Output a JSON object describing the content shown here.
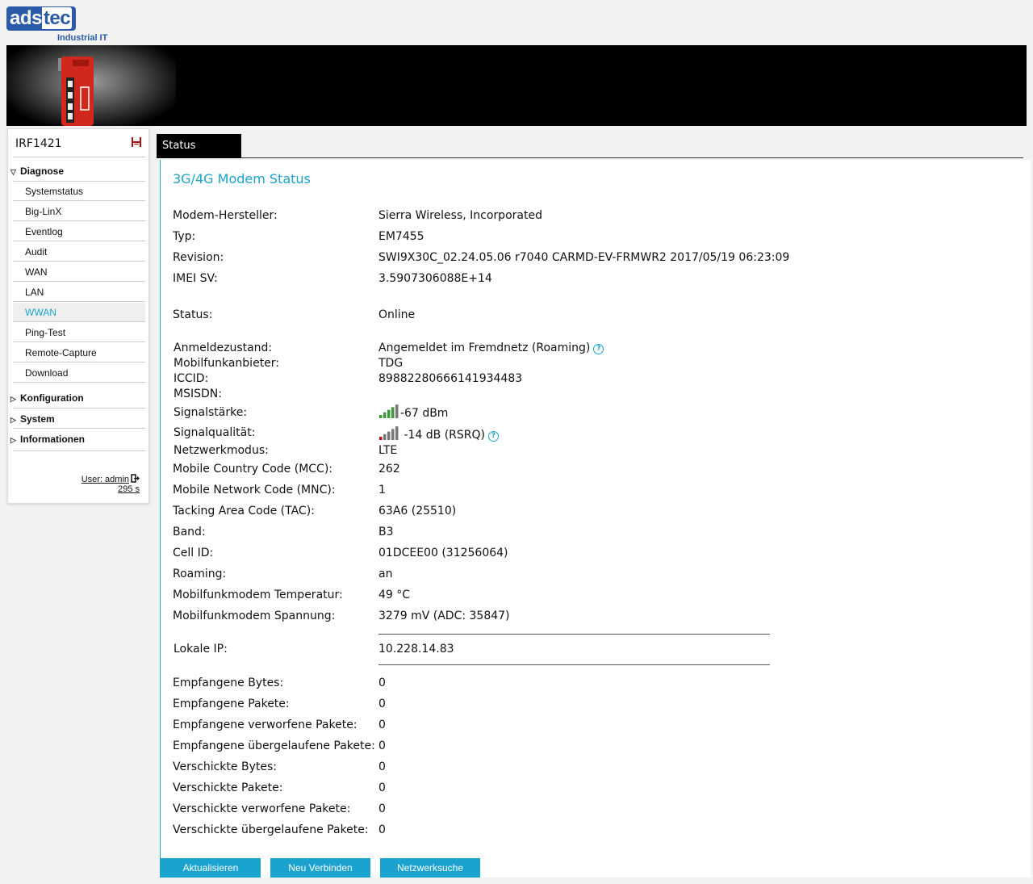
{
  "logo": {
    "left_text": "ads",
    "right_text": "tec",
    "subtitle": "Industrial IT"
  },
  "sidebar": {
    "device_name": "IRF1421",
    "groups": [
      {
        "label": "Diagnose",
        "expanded": true
      },
      {
        "label": "Konfiguration",
        "expanded": false
      },
      {
        "label": "System",
        "expanded": false
      },
      {
        "label": "Informationen",
        "expanded": false
      }
    ],
    "items": [
      "Systemstatus",
      "Big-LinX",
      "Eventlog",
      "Audit",
      "WAN",
      "LAN",
      "WWAN",
      "Ping-Test",
      "Remote-Capture",
      "Download"
    ],
    "active_item": "WWAN",
    "user": "User: admin",
    "timer": "295 s"
  },
  "tab": {
    "label": "Status"
  },
  "main": {
    "title": "3G/4G Modem Status",
    "rows": [
      {
        "label": "Modem-Hersteller:",
        "value": "Sierra Wireless, Incorporated"
      },
      {
        "label": "Typ:",
        "value": "EM7455"
      },
      {
        "label": "Revision:",
        "value": "SWI9X30C_02.24.05.06 r7040 CARMD-EV-FRMWR2 2017/05/19 06:23:09"
      },
      {
        "label": "IMEI SV:",
        "value": "3.5907306088E+14"
      },
      {
        "label": "Status:",
        "value": "Online"
      },
      {
        "label": "Anmeldezustand:",
        "value": "Angemeldet im Fremdnetz (Roaming)"
      },
      {
        "label": "Mobilfunkanbieter:",
        "value": "TDG"
      },
      {
        "label": "ICCID:",
        "value": "89882280666141934483"
      },
      {
        "label": "MSISDN:",
        "value": ""
      },
      {
        "label": "Signalstärke:",
        "value": "-67 dBm"
      },
      {
        "label": "Signalqualität:",
        "value": "-14 dB (RSRQ)"
      },
      {
        "label": "Netzwerkmodus:",
        "value": "LTE"
      },
      {
        "label": "Mobile Country Code (MCC):",
        "value": "262"
      },
      {
        "label": "Mobile Network Code (MNC):",
        "value": "1"
      },
      {
        "label": "Tacking Area Code (TAC):",
        "value": "63A6 (25510)"
      },
      {
        "label": "Band:",
        "value": "B3"
      },
      {
        "label": "Cell ID:",
        "value": "01DCEE00 (31256064)"
      },
      {
        "label": "Roaming:",
        "value": "an"
      },
      {
        "label": "Mobilfunkmodem Temperatur:",
        "value": "49 °C"
      },
      {
        "label": "Mobilfunkmodem Spannung:",
        "value": "3279 mV (ADC: 35847)"
      },
      {
        "label": "Lokale IP:",
        "value": "10.228.14.83"
      },
      {
        "label": "Empfangene Bytes:",
        "value": "0"
      },
      {
        "label": "Empfangene Pakete:",
        "value": "0"
      },
      {
        "label": "Empfangene verworfene Pakete:",
        "value": "0"
      },
      {
        "label": "Empfangene übergelaufene Pakete:",
        "value": "0"
      },
      {
        "label": "Verschickte Bytes:",
        "value": "0"
      },
      {
        "label": "Verschickte Pakete:",
        "value": "0"
      },
      {
        "label": "Verschickte verworfene Pakete:",
        "value": "0"
      },
      {
        "label": "Verschickte übergelaufene Pakete:",
        "value": "0"
      }
    ],
    "signal_strength_bars": 4,
    "signal_quality_bars": 1,
    "signal_max_bars": 5
  },
  "buttons": {
    "refresh": "Aktualisieren",
    "reconnect": "Neu Verbinden",
    "network_search": "Netzwerksuche"
  },
  "colors": {
    "accent": "#1aa3cf",
    "banner": "#000000",
    "brand": "#2a5aa8"
  }
}
